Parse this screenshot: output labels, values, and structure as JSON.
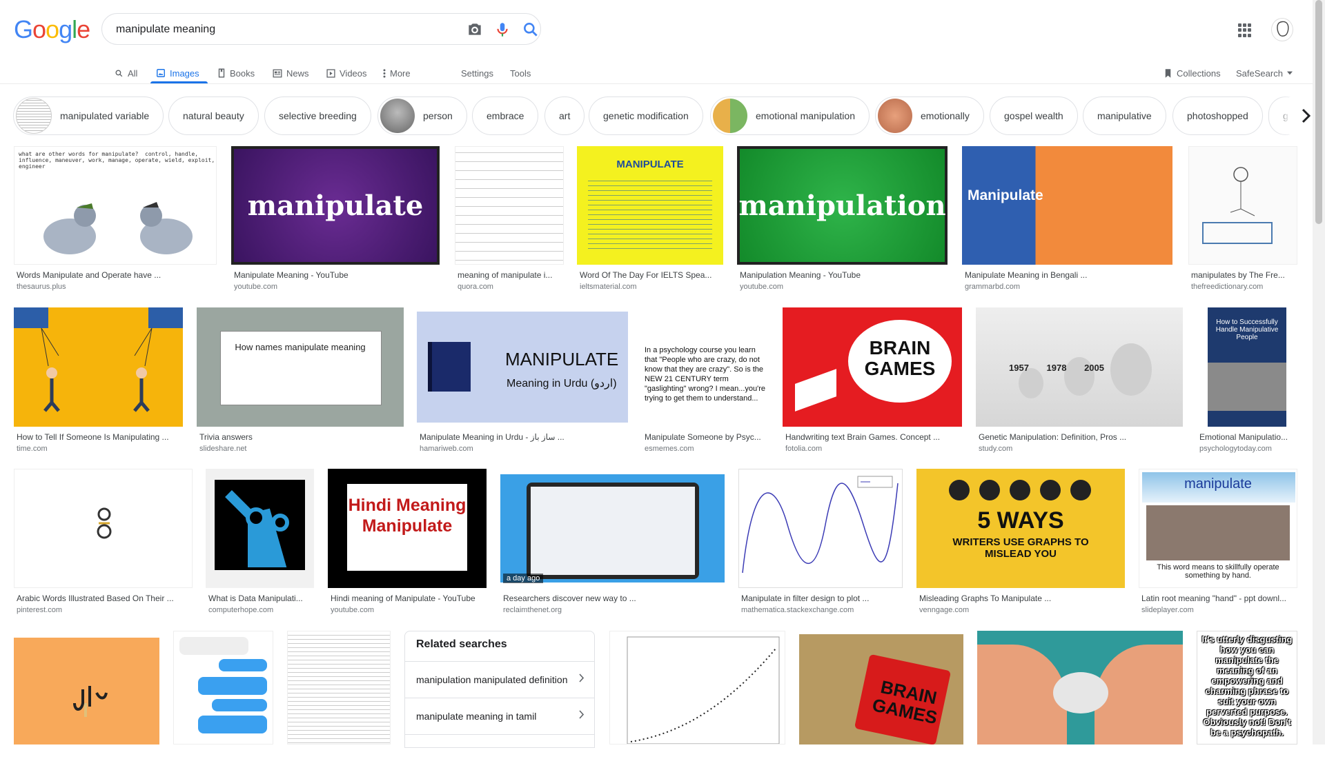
{
  "header": {
    "logo_letters": [
      {
        "ch": "G",
        "color": "#4285F4"
      },
      {
        "ch": "o",
        "color": "#EA4335"
      },
      {
        "ch": "o",
        "color": "#FBBC05"
      },
      {
        "ch": "g",
        "color": "#4285F4"
      },
      {
        "ch": "l",
        "color": "#34A853"
      },
      {
        "ch": "e",
        "color": "#EA4335"
      }
    ],
    "search_value": "manipulate meaning",
    "icons": [
      "camera-icon",
      "microphone-icon",
      "search-icon",
      "apps-grid-icon",
      "account-avatar"
    ]
  },
  "tabs": [
    {
      "label": "All",
      "icon": "search-icon"
    },
    {
      "label": "Images",
      "icon": "image-icon",
      "active": true
    },
    {
      "label": "Books",
      "icon": "book-icon"
    },
    {
      "label": "News",
      "icon": "news-icon"
    },
    {
      "label": "Videos",
      "icon": "video-icon"
    },
    {
      "label": "More",
      "icon": "more-vert-icon"
    }
  ],
  "tools": {
    "settings": "Settings",
    "tools": "Tools",
    "collections": "Collections",
    "safesearch": "SafeSearch"
  },
  "chips": [
    {
      "label": "manipulated variable",
      "thumb": true
    },
    {
      "label": "natural beauty"
    },
    {
      "label": "selective breeding"
    },
    {
      "label": "person",
      "thumb": true
    },
    {
      "label": "embrace"
    },
    {
      "label": "art"
    },
    {
      "label": "genetic modification"
    },
    {
      "label": "emotional manipulation",
      "thumb": true
    },
    {
      "label": "emotionally",
      "thumb": true
    },
    {
      "label": "gospel wealth"
    },
    {
      "label": "manipulative"
    },
    {
      "label": "photoshopped"
    },
    {
      "label": "g"
    }
  ],
  "results_row1": [
    {
      "caption": "Words Manipulate and Operate have ...",
      "source": "thesaurus.plus",
      "art": "what are other words for manipulate?  control, handle, influence, maneuver, work, manage, operate, wield, exploit, engineer"
    },
    {
      "caption": "Manipulate Meaning - YouTube",
      "source": "youtube.com",
      "art": "manipulate"
    },
    {
      "caption": "meaning of manipulate i...",
      "source": "quora.com",
      "art": ""
    },
    {
      "caption": "Word Of The Day For IELTS Spea...",
      "source": "ieltsmaterial.com",
      "art": "MANIPULATE"
    },
    {
      "caption": "Manipulation Meaning - YouTube",
      "source": "youtube.com",
      "art": "manipulation"
    },
    {
      "caption": "Manipulate Meaning in Bengali ...",
      "source": "grammarbd.com",
      "art": "Manipulate"
    },
    {
      "caption": "manipulates by The Fre...",
      "source": "thefreedictionary.com",
      "art": ""
    }
  ],
  "results_row2": [
    {
      "caption": "How to Tell If Someone Is Manipulating ...",
      "source": "time.com",
      "art": ""
    },
    {
      "caption": "Trivia answers",
      "source": "slideshare.net",
      "art": "How names manipulate meaning"
    },
    {
      "caption": "Manipulate Meaning in Urdu - ساز باز ...",
      "source": "hamariweb.com",
      "art": "MANIPULATE",
      "art2": "Meaning in Urdu (اردو)"
    },
    {
      "caption": "Manipulate Someone by Psyc...",
      "source": "esmemes.com",
      "art": "In a psychology course you learn that \"People who are crazy, do not know that they are crazy\". So is the NEW 21 CENTURY term \"gaslighting\" wrong? I mean...you're trying to get them to understand..."
    },
    {
      "caption": "Handwriting text Brain Games. Concept ...",
      "source": "fotolia.com",
      "art": "BRAIN GAMES"
    },
    {
      "caption": "Genetic Manipulation: Definition, Pros ...",
      "source": "study.com",
      "art": "1957   1978   2005"
    },
    {
      "caption": "Emotional Manipulatio...",
      "source": "psychologytoday.com",
      "art": "How to Successfully Handle Manipulative People"
    }
  ],
  "results_row3": [
    {
      "caption": "Arabic Words Illustrated Based On Their ...",
      "source": "pinterest.com",
      "art": ""
    },
    {
      "caption": "What is Data Manipulati...",
      "source": "computerhope.com",
      "art": ""
    },
    {
      "caption": "Hindi meaning of Manipulate - YouTube",
      "source": "youtube.com",
      "art": "Hindi Meaning Manipulate"
    },
    {
      "caption": "Researchers discover new way to ...",
      "source": "reclaimthenet.org",
      "art": "a day ago"
    },
    {
      "caption": "Manipulate in filter design to plot ...",
      "source": "mathematica.stackexchange.com",
      "art": ""
    },
    {
      "caption": "Misleading Graphs To Manipulate ...",
      "source": "venngage.com",
      "art": "5 WAYS",
      "art2": "WRITERS USE GRAPHS TO MISLEAD YOU"
    },
    {
      "caption": "Latin root meaning \"hand\" - ppt downl...",
      "source": "slideplayer.com",
      "art": "manipulate",
      "art2": "This word means to skillfully operate something by hand."
    }
  ],
  "results_row4": [
    {
      "art": ""
    },
    {
      "art": ""
    },
    {
      "art": ""
    },
    {
      "art": ""
    },
    {
      "art": "BRAIN GAMES"
    },
    {
      "art": ""
    },
    {
      "art": "It's utterly disgusting how you can manipulate the meaning of an empowering and charming phrase to suit your own perverted purpose. Obviously not! Don't be a psychopath."
    }
  ],
  "related": {
    "title": "Related searches",
    "items": [
      "manipulation manipulated definition",
      "manipulate meaning in tamil"
    ]
  },
  "colors": {
    "accent": "#1a73e8",
    "text": "#202124",
    "muted": "#70757a"
  }
}
